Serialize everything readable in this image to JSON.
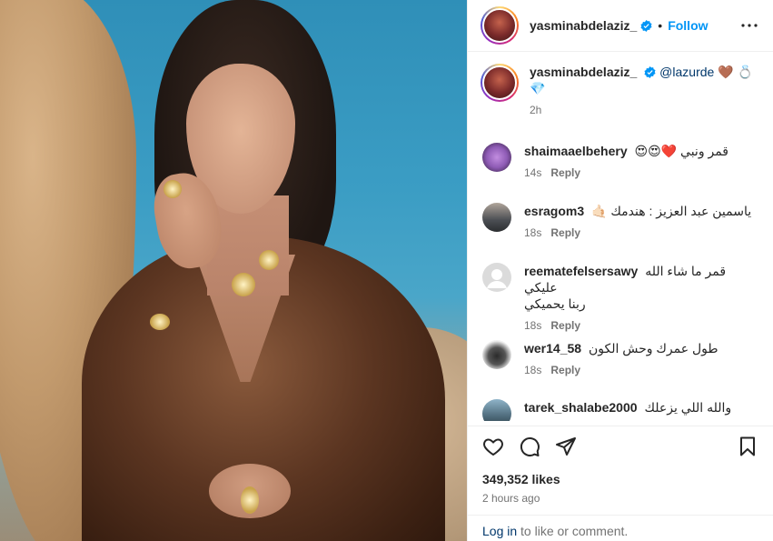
{
  "post": {
    "author": "yasminabdelaziz_",
    "follow_label": "Follow",
    "separator": "•"
  },
  "caption": {
    "author": "yasminabdelaziz_",
    "mention": "@lazurde",
    "emojis_line1": " 🤎 💍",
    "emojis_line2": "💎",
    "time": "2h"
  },
  "comments": [
    {
      "user": "shaimaaelbehery",
      "text": "قمر ونبي ❤️😍😍",
      "time": "14s",
      "reply_label": "Reply",
      "avatar_color": "#8e5bb5"
    },
    {
      "user": "esragom3",
      "text": "ياسمين عبد العزيز : هندمك 🤙🏻",
      "time": "18s",
      "reply_label": "Reply",
      "avatar_color": "#6b6f74"
    },
    {
      "user": "reematefelsersawy",
      "text": "قمر ما شاء الله عليكي",
      "text2": "ربنا يحميكي",
      "time": "18s",
      "reply_label": "Reply",
      "avatar_color": "#dbdbdb"
    },
    {
      "user": "wer14_58",
      "text": "طول عمرك وحش الكون",
      "time": "18s",
      "reply_label": "Reply",
      "avatar_color": "#3a3a3a"
    },
    {
      "user": "tarek_shalabe2000",
      "text": "والله اللي يزعلك",
      "time": "",
      "reply_label": "",
      "avatar_color": "#4d6a7a"
    }
  ],
  "actions": {
    "like_icon": "heart-icon",
    "comment_icon": "comment-icon",
    "share_icon": "paper-plane-icon",
    "save_icon": "bookmark-icon"
  },
  "stats": {
    "likes": "349,352 likes",
    "time_ago": "2 hours ago"
  },
  "footer": {
    "login_label": "Log in",
    "rest": " to like or comment."
  },
  "colors": {
    "accent": "#0095f6",
    "verified": "#0095f6",
    "muted": "#737373"
  }
}
